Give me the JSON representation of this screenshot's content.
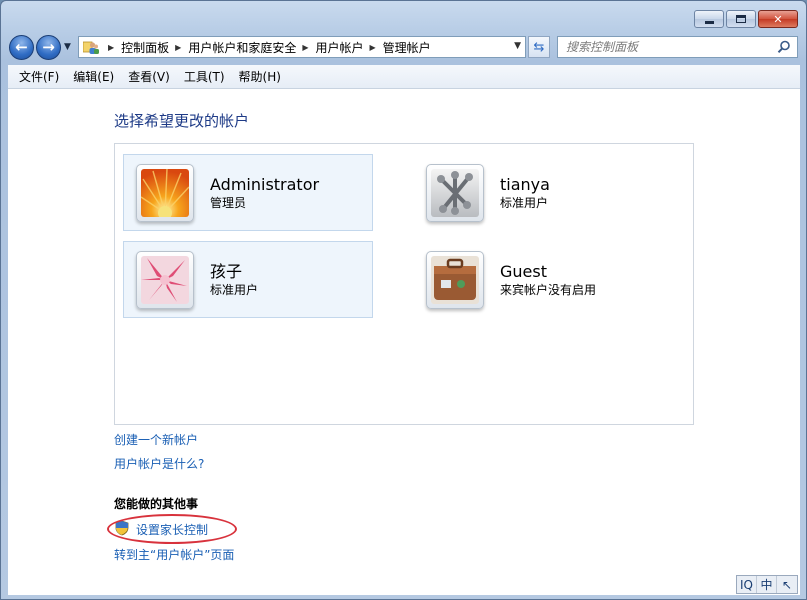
{
  "window": {
    "caption_buttons": {
      "minimize": "minimize-icon",
      "maximize": "maximize-icon",
      "close_glyph": "✕"
    }
  },
  "nav": {
    "back_glyph": "←",
    "forward_glyph": "→",
    "breadcrumbs": [
      "控制面板",
      "用户帐户和家庭安全",
      "用户帐户",
      "管理帐户"
    ],
    "search_placeholder": "搜索控制面板"
  },
  "menu": [
    "文件(F)",
    "编辑(E)",
    "查看(V)",
    "工具(T)",
    "帮助(H)"
  ],
  "main": {
    "heading": "选择希望更改的帐户",
    "accounts": [
      {
        "name": "Administrator",
        "type": "管理员",
        "picture": "orange-flower"
      },
      {
        "name": "tianya",
        "type": "标准用户",
        "picture": "silver-jacks"
      },
      {
        "name": "孩子",
        "type": "标准用户",
        "picture": "pink-flower"
      },
      {
        "name": "Guest",
        "type": "来宾帐户没有启用",
        "picture": "suitcase"
      }
    ],
    "links": {
      "create": "创建一个新帐户",
      "what_is": "用户帐户是什么?"
    },
    "other_heading": "您能做的其他事",
    "other_links": {
      "parental": "设置家长控制",
      "goto_main": "转到主“用户帐户”页面"
    }
  },
  "ime": {
    "items": [
      "IQ",
      "中",
      "↖"
    ]
  },
  "colors": {
    "link": "#1a5fb4",
    "heading": "#1e3b87",
    "highlight": "#d8323c"
  }
}
